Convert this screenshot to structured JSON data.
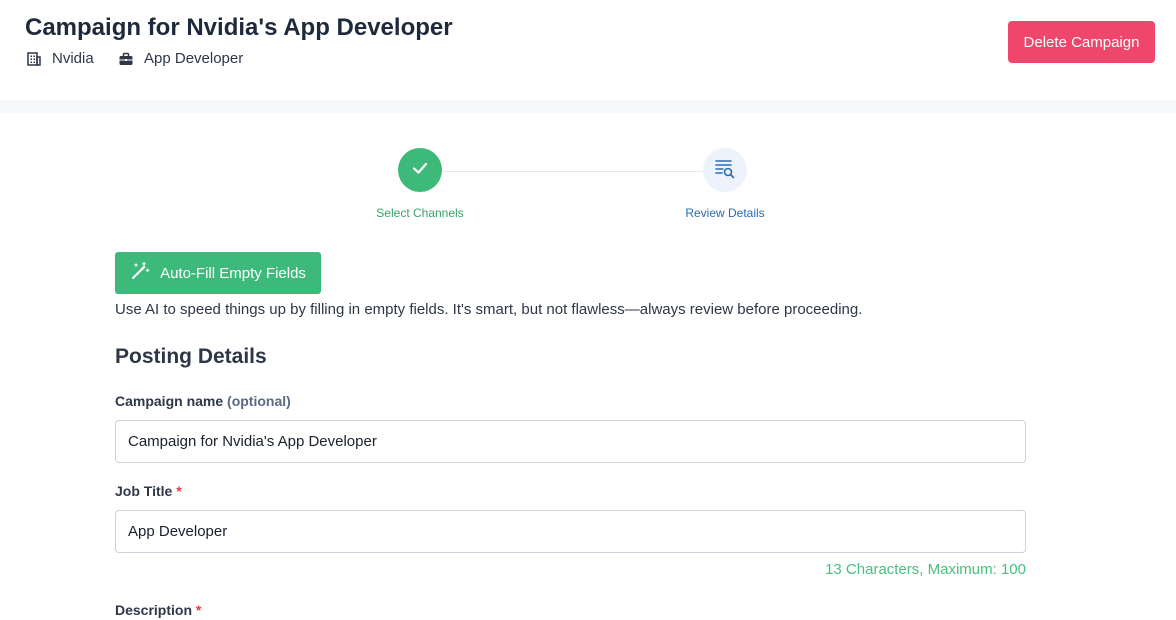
{
  "header": {
    "title": "Campaign for Nvidia's App Developer",
    "company": "Nvidia",
    "job": "App Developer",
    "delete_label": "Delete Campaign"
  },
  "stepper": {
    "steps": [
      {
        "label": "Select Channels",
        "status": "complete"
      },
      {
        "label": "Review Details",
        "status": "current"
      }
    ]
  },
  "autofill": {
    "button_label": "Auto-Fill Empty Fields",
    "help_text": "Use AI to speed things up by filling in empty fields. It's smart, but not flawless—always review before proceeding."
  },
  "form": {
    "section_title": "Posting Details",
    "campaign_name": {
      "label": "Campaign name",
      "optional_tag": "(optional)",
      "value": "Campaign for Nvidia's App Developer"
    },
    "job_title": {
      "label": "Job Title",
      "required_mark": "*",
      "value": "App Developer",
      "char_count": "13 Characters, Maximum: 100"
    },
    "description": {
      "label": "Description",
      "required_mark": "*"
    }
  },
  "colors": {
    "danger": "#f0466b",
    "success": "#3dba7a",
    "link": "#2b6cb0"
  },
  "icons": [
    "building-icon",
    "briefcase-icon",
    "check-icon",
    "review-search-icon",
    "magic-wand-icon"
  ]
}
